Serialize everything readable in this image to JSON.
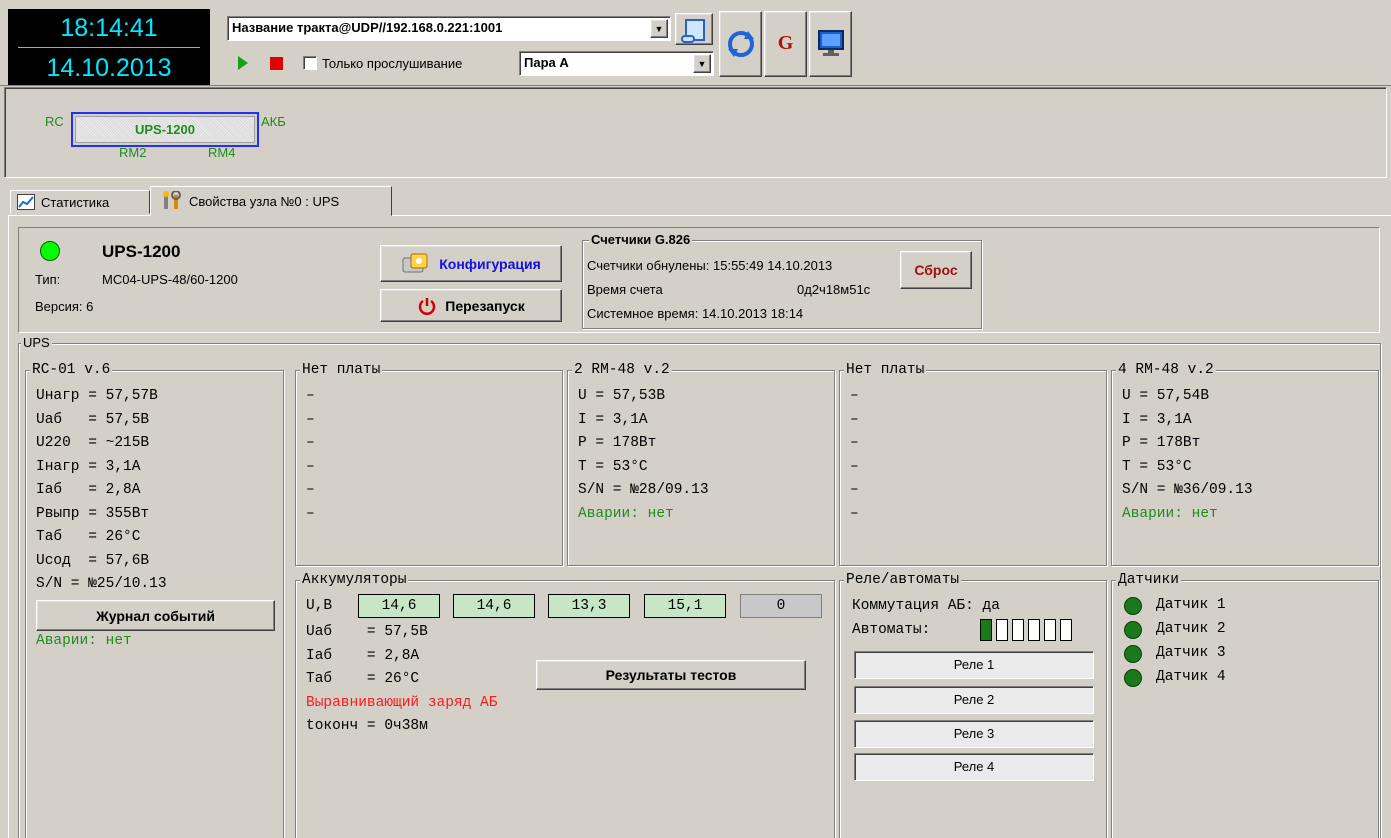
{
  "clock": {
    "time": "18:14:41",
    "date": "14.10.2013"
  },
  "toolbar": {
    "channel_value": "Название тракта@UDP//192.168.0.221:1001",
    "listen_only_label": "Только прослушивание",
    "pair_value": "Пара А",
    "g_label": "G"
  },
  "topology": {
    "node_label": "UPS-1200",
    "left_label": "RC",
    "right_label": "АКБ",
    "bottom_left_label": "RM2",
    "bottom_right_label": "RM4"
  },
  "tabs": [
    {
      "label": "Статистика"
    },
    {
      "label": "Свойства узла №0 : UPS"
    }
  ],
  "node": {
    "name": "UPS-1200",
    "type_label": "Тип:",
    "type_value": "MC04-UPS-48/60-1200",
    "version_label": "Версия: 6",
    "config_button": "Конфигурация",
    "restart_button": "Перезапуск",
    "status_color": "#00ff00"
  },
  "counters": {
    "title": "Счетчики G.826",
    "reset_text": "Счетчики обнулены: 15:55:49 14.10.2013",
    "count_time_label": "Время счета",
    "count_time_value": "0д2ч18м51с",
    "system_time": "Системное время: 14.10.2013  18:14",
    "reset_button": "Сброс"
  },
  "ups_group_title": "UPS",
  "rc": {
    "title": "RC-01 v.6",
    "lines": [
      "Uнагр = 57,57В",
      "Uаб   = 57,5В",
      "U220  = ~215В",
      "Iнагр = 3,1А",
      "Iаб   = 2,8А",
      "Pвыпр = 355Вт",
      "Tаб   = 26°C",
      "Uсод  = 57,6В",
      "S/N = №25/10.13"
    ],
    "journal_button": "Журнал событий",
    "alarms": "Аварии: нет"
  },
  "slot1": {
    "title": "Нет платы",
    "lines": [
      "–",
      "–",
      "–",
      "–",
      "–",
      "–"
    ]
  },
  "slot2": {
    "title": "2 RM-48 v.2",
    "lines": [
      "U = 57,53В",
      "I = 3,1А",
      "P = 178Вт",
      "T = 53°C",
      "S/N = №28/09.13"
    ],
    "alarms": "Аварии: нет"
  },
  "slot3": {
    "title": "Нет платы",
    "lines": [
      "–",
      "–",
      "–",
      "–",
      "–",
      "–"
    ]
  },
  "slot4": {
    "title": "4 RM-48 v.2",
    "lines": [
      "U = 57,54В",
      "I = 3,1А",
      "P = 178Вт",
      "T = 53°C",
      "S/N = №36/09.13"
    ],
    "alarms": "Аварии: нет"
  },
  "batteries": {
    "title": "Аккумуляторы",
    "u_label": "U,В",
    "cells": [
      "14,6",
      "14,6",
      "13,3",
      "15,1",
      "0"
    ],
    "lines": [
      "Uаб    = 57,5В",
      "Iаб    = 2,8А",
      "Tаб    = 26°C"
    ],
    "charge_status": "Выравнивающий заряд АБ",
    "t_end": "tоконч = 0ч38м",
    "tests_button": "Результаты тестов"
  },
  "relays": {
    "title": "Реле/автоматы",
    "switching": "Коммутация АБ: да",
    "breakers_label": "Автоматы:",
    "breakers": [
      true,
      false,
      false,
      false,
      false,
      false
    ],
    "items": [
      "Реле 1",
      "Реле 2",
      "Реле 3",
      "Реле 4"
    ]
  },
  "sensors": {
    "title": "Датчики",
    "items": [
      "Датчик 1",
      "Датчик 2",
      "Датчик 3",
      "Датчик 4"
    ]
  }
}
